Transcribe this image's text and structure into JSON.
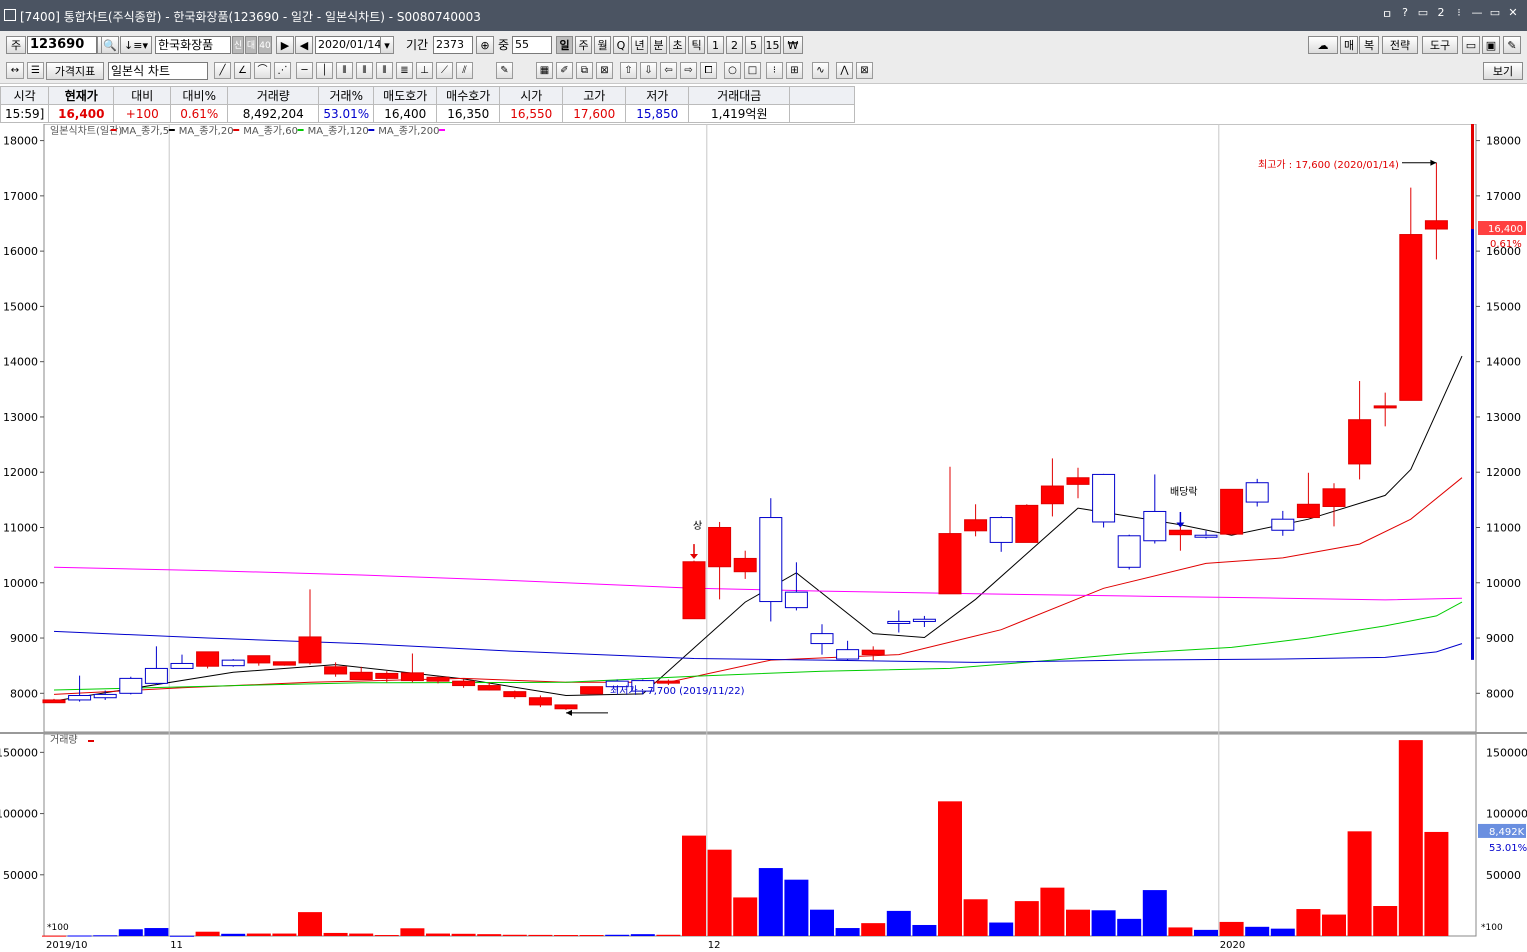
{
  "window": {
    "title": "[7400] 통합차트(주식종합) - 한국화장품(123690 - 일간 - 일본식차트) - S0080740003",
    "controls": [
      "ㅁ",
      "?",
      "▭",
      "2",
      "⁝",
      "—",
      "▭",
      "✕"
    ]
  },
  "toolbar": {
    "market_btn": "주",
    "code": "123690",
    "name": "한국화장품",
    "badges": [
      "신",
      "대",
      "40"
    ],
    "date": "2020/01/14",
    "period_label": "기간",
    "period_value": "2373",
    "count_label": "중",
    "count_value": "55",
    "period_buttons": [
      "일",
      "주",
      "월",
      "Q",
      "년",
      "분",
      "초",
      "틱",
      "1",
      "2",
      "5",
      "15",
      "₩"
    ],
    "selected_period": "일",
    "right_buttons": [
      "매",
      "복",
      "전략",
      "도구"
    ],
    "indicator_btn": "가격지표",
    "chart_type": "일본식 차트",
    "view_btn": "보기"
  },
  "quote": {
    "headers": [
      "시각",
      "현재가",
      "대비",
      "대비%",
      "거래량",
      "거래%",
      "매도호가",
      "매수호가",
      "시가",
      "고가",
      "저가",
      "거래대금"
    ],
    "values": [
      "15:59]",
      "16,400",
      "+100",
      "0.61%",
      "8,492,204",
      "53.01%",
      "16,400",
      "16,350",
      "16,550",
      "17,600",
      "15,850",
      "1,419억원"
    ]
  },
  "price_legend": [
    {
      "text": "일본식차트(일간)",
      "color": "#e00000"
    },
    {
      "text": "MA_종가,5",
      "color": "#000000"
    },
    {
      "text": "MA_종가,20",
      "color": "#e00000"
    },
    {
      "text": "MA_종가,60",
      "color": "#00cc00"
    },
    {
      "text": "MA_종가,120",
      "color": "#0000cc"
    },
    {
      "text": "MA_종가,200",
      "color": "#ff00ff"
    }
  ],
  "annotations": {
    "high": "최고가 : 17,600 (2020/01/14)",
    "low": "최저가 : 7,700 (2019/11/22)",
    "upper_limit": "상",
    "dividend": "배당락"
  },
  "last_price_tag": {
    "price": "16,400",
    "pct": "0.61%"
  },
  "volume_legend": "거래량",
  "volume_last_tag": {
    "value": "8,492K",
    "pct": "53.01%"
  },
  "volume_unit": "*100",
  "x_labels": [
    "2019/10",
    "11",
    "12",
    "2020"
  ],
  "chart_data": {
    "type": "candlestick",
    "title": "일본식차트(일간)",
    "ylim": [
      7300,
      18300
    ],
    "y_ticks": [
      8000,
      9000,
      10000,
      11000,
      12000,
      13000,
      14000,
      15000,
      16000,
      17000,
      18000
    ],
    "candles": [
      {
        "o": 7880,
        "h": 7900,
        "l": 7830,
        "c": 7830
      },
      {
        "o": 7880,
        "h": 8320,
        "l": 7850,
        "c": 7960
      },
      {
        "o": 7920,
        "h": 8050,
        "l": 7880,
        "c": 7980
      },
      {
        "o": 8000,
        "h": 8300,
        "l": 7980,
        "c": 8270
      },
      {
        "o": 8180,
        "h": 8850,
        "l": 8150,
        "c": 8450
      },
      {
        "o": 8450,
        "h": 8700,
        "l": 8450,
        "c": 8540
      },
      {
        "o": 8750,
        "h": 8750,
        "l": 8450,
        "c": 8490
      },
      {
        "o": 8500,
        "h": 8620,
        "l": 8480,
        "c": 8600
      },
      {
        "o": 8680,
        "h": 8680,
        "l": 8500,
        "c": 8550
      },
      {
        "o": 8570,
        "h": 8570,
        "l": 8500,
        "c": 8510
      },
      {
        "o": 9020,
        "h": 9880,
        "l": 8520,
        "c": 8550
      },
      {
        "o": 8480,
        "h": 8560,
        "l": 8300,
        "c": 8350
      },
      {
        "o": 8380,
        "h": 8480,
        "l": 8250,
        "c": 8250
      },
      {
        "o": 8360,
        "h": 8400,
        "l": 8200,
        "c": 8270
      },
      {
        "o": 8370,
        "h": 8720,
        "l": 8200,
        "c": 8230
      },
      {
        "o": 8290,
        "h": 8300,
        "l": 8180,
        "c": 8220
      },
      {
        "o": 8220,
        "h": 8250,
        "l": 8100,
        "c": 8140
      },
      {
        "o": 8140,
        "h": 8200,
        "l": 8050,
        "c": 8060
      },
      {
        "o": 8030,
        "h": 8050,
        "l": 7900,
        "c": 7940
      },
      {
        "o": 7920,
        "h": 7960,
        "l": 7750,
        "c": 7790
      },
      {
        "o": 7790,
        "h": 7790,
        "l": 7700,
        "c": 7720
      },
      {
        "o": 8120,
        "h": 8120,
        "l": 7990,
        "c": 7990
      },
      {
        "o": 8120,
        "h": 8250,
        "l": 8050,
        "c": 8220
      },
      {
        "o": 8040,
        "h": 8250,
        "l": 7980,
        "c": 8230
      },
      {
        "o": 8220,
        "h": 8250,
        "l": 8150,
        "c": 8200
      },
      {
        "o": 10380,
        "h": 10400,
        "l": 9350,
        "c": 9350
      },
      {
        "o": 11000,
        "h": 11100,
        "l": 9700,
        "c": 10290
      },
      {
        "o": 10440,
        "h": 10580,
        "l": 10070,
        "c": 10200
      },
      {
        "o": 9660,
        "h": 11530,
        "l": 9300,
        "c": 11180
      },
      {
        "o": 9550,
        "h": 10370,
        "l": 9500,
        "c": 9830
      },
      {
        "o": 8900,
        "h": 9250,
        "l": 8700,
        "c": 9080
      },
      {
        "o": 8620,
        "h": 8950,
        "l": 8600,
        "c": 8790
      },
      {
        "o": 8780,
        "h": 8850,
        "l": 8600,
        "c": 8700
      },
      {
        "o": 9300,
        "h": 9500,
        "l": 9100,
        "c": 9300
      },
      {
        "o": 9300,
        "h": 9400,
        "l": 9200,
        "c": 9340
      },
      {
        "o": 10890,
        "h": 12100,
        "l": 9800,
        "c": 9800
      },
      {
        "o": 11140,
        "h": 11420,
        "l": 10840,
        "c": 10940
      },
      {
        "o": 10730,
        "h": 11200,
        "l": 10560,
        "c": 11180
      },
      {
        "o": 11400,
        "h": 11420,
        "l": 10730,
        "c": 10730
      },
      {
        "o": 11750,
        "h": 12250,
        "l": 11200,
        "c": 11430
      },
      {
        "o": 11900,
        "h": 12080,
        "l": 11530,
        "c": 11780
      },
      {
        "o": 11100,
        "h": 11970,
        "l": 11000,
        "c": 11960
      },
      {
        "o": 10280,
        "h": 10870,
        "l": 10240,
        "c": 10850
      },
      {
        "o": 10760,
        "h": 11960,
        "l": 10710,
        "c": 11290
      },
      {
        "o": 10950,
        "h": 11140,
        "l": 10580,
        "c": 10870
      },
      {
        "o": 10840,
        "h": 10940,
        "l": 10800,
        "c": 10860
      },
      {
        "o": 11690,
        "h": 11690,
        "l": 10880,
        "c": 10880
      },
      {
        "o": 11460,
        "h": 11880,
        "l": 11380,
        "c": 11810
      },
      {
        "o": 10950,
        "h": 11300,
        "l": 10850,
        "c": 11150
      },
      {
        "o": 11420,
        "h": 11990,
        "l": 11180,
        "c": 11180
      },
      {
        "o": 11700,
        "h": 11800,
        "l": 11020,
        "c": 11380
      },
      {
        "o": 12950,
        "h": 13650,
        "l": 11870,
        "c": 12150
      },
      {
        "o": 13200,
        "h": 13440,
        "l": 12830,
        "c": 13170
      },
      {
        "o": 16300,
        "h": 17150,
        "l": 13300,
        "c": 13300
      },
      {
        "o": 16550,
        "h": 17600,
        "l": 15850,
        "c": 16400
      }
    ],
    "ma": [
      {
        "name": "MA_종가,5",
        "color": "#000000",
        "points": [
          [
            0,
            7860
          ],
          [
            7,
            8380
          ],
          [
            11,
            8520
          ],
          [
            16,
            8260
          ],
          [
            20,
            7960
          ],
          [
            23,
            7990
          ],
          [
            27,
            9650
          ],
          [
            29,
            10180
          ],
          [
            32,
            9080
          ],
          [
            34,
            9010
          ],
          [
            36,
            9700
          ],
          [
            40,
            11350
          ],
          [
            44,
            11050
          ],
          [
            46,
            10860
          ],
          [
            49,
            11150
          ],
          [
            52,
            11580
          ],
          [
            53,
            12050
          ],
          [
            55,
            14100
          ]
        ]
      },
      {
        "name": "MA_종가,20",
        "color": "#e00000",
        "points": [
          [
            0,
            7980
          ],
          [
            5,
            8100
          ],
          [
            10,
            8200
          ],
          [
            16,
            8270
          ],
          [
            20,
            8200
          ],
          [
            24,
            8200
          ],
          [
            28,
            8600
          ],
          [
            33,
            8700
          ],
          [
            37,
            9150
          ],
          [
            41,
            9900
          ],
          [
            45,
            10350
          ],
          [
            48,
            10450
          ],
          [
            51,
            10700
          ],
          [
            53,
            11150
          ],
          [
            55,
            11900
          ]
        ]
      },
      {
        "name": "MA_종가,60",
        "color": "#00cc00",
        "points": [
          [
            0,
            8060
          ],
          [
            8,
            8150
          ],
          [
            12,
            8190
          ],
          [
            20,
            8200
          ],
          [
            25,
            8310
          ],
          [
            30,
            8400
          ],
          [
            35,
            8450
          ],
          [
            39,
            8600
          ],
          [
            42,
            8720
          ],
          [
            46,
            8830
          ],
          [
            49,
            9000
          ],
          [
            52,
            9220
          ],
          [
            54,
            9400
          ],
          [
            55,
            9650
          ]
        ]
      },
      {
        "name": "MA_종가,120",
        "color": "#0000cc",
        "points": [
          [
            0,
            9120
          ],
          [
            6,
            9000
          ],
          [
            12,
            8900
          ],
          [
            18,
            8760
          ],
          [
            25,
            8630
          ],
          [
            30,
            8600
          ],
          [
            36,
            8560
          ],
          [
            42,
            8600
          ],
          [
            48,
            8620
          ],
          [
            52,
            8650
          ],
          [
            54,
            8750
          ],
          [
            55,
            8900
          ]
        ]
      },
      {
        "name": "MA_종가,200",
        "color": "#ff00ff",
        "points": [
          [
            0,
            10280
          ],
          [
            6,
            10220
          ],
          [
            12,
            10140
          ],
          [
            18,
            10040
          ],
          [
            25,
            9900
          ],
          [
            30,
            9850
          ],
          [
            36,
            9800
          ],
          [
            42,
            9760
          ],
          [
            48,
            9720
          ],
          [
            52,
            9690
          ],
          [
            55,
            9720
          ]
        ]
      }
    ],
    "volume": {
      "ylim": [
        0,
        165000
      ],
      "y_ticks": [
        50000,
        100000,
        150000
      ],
      "values": [
        300,
        400,
        600,
        5500,
        6500,
        200,
        3500,
        1800,
        2000,
        2000,
        19500,
        2500,
        2000,
        800,
        6300,
        2000,
        1800,
        1500,
        1000,
        900,
        800,
        800,
        1000,
        1500,
        1000,
        82000,
        70500,
        31500,
        55500,
        46000,
        21500,
        6500,
        10500,
        20500,
        9000,
        110000,
        30000,
        11000,
        28500,
        39500,
        21500,
        21000,
        14000,
        37500,
        7000,
        5000,
        11500,
        7500,
        6000,
        22000,
        17500,
        85500,
        24500,
        160000,
        85000
      ]
    },
    "x_labels": [
      "2019/10",
      "11",
      "12",
      "2020"
    ]
  }
}
